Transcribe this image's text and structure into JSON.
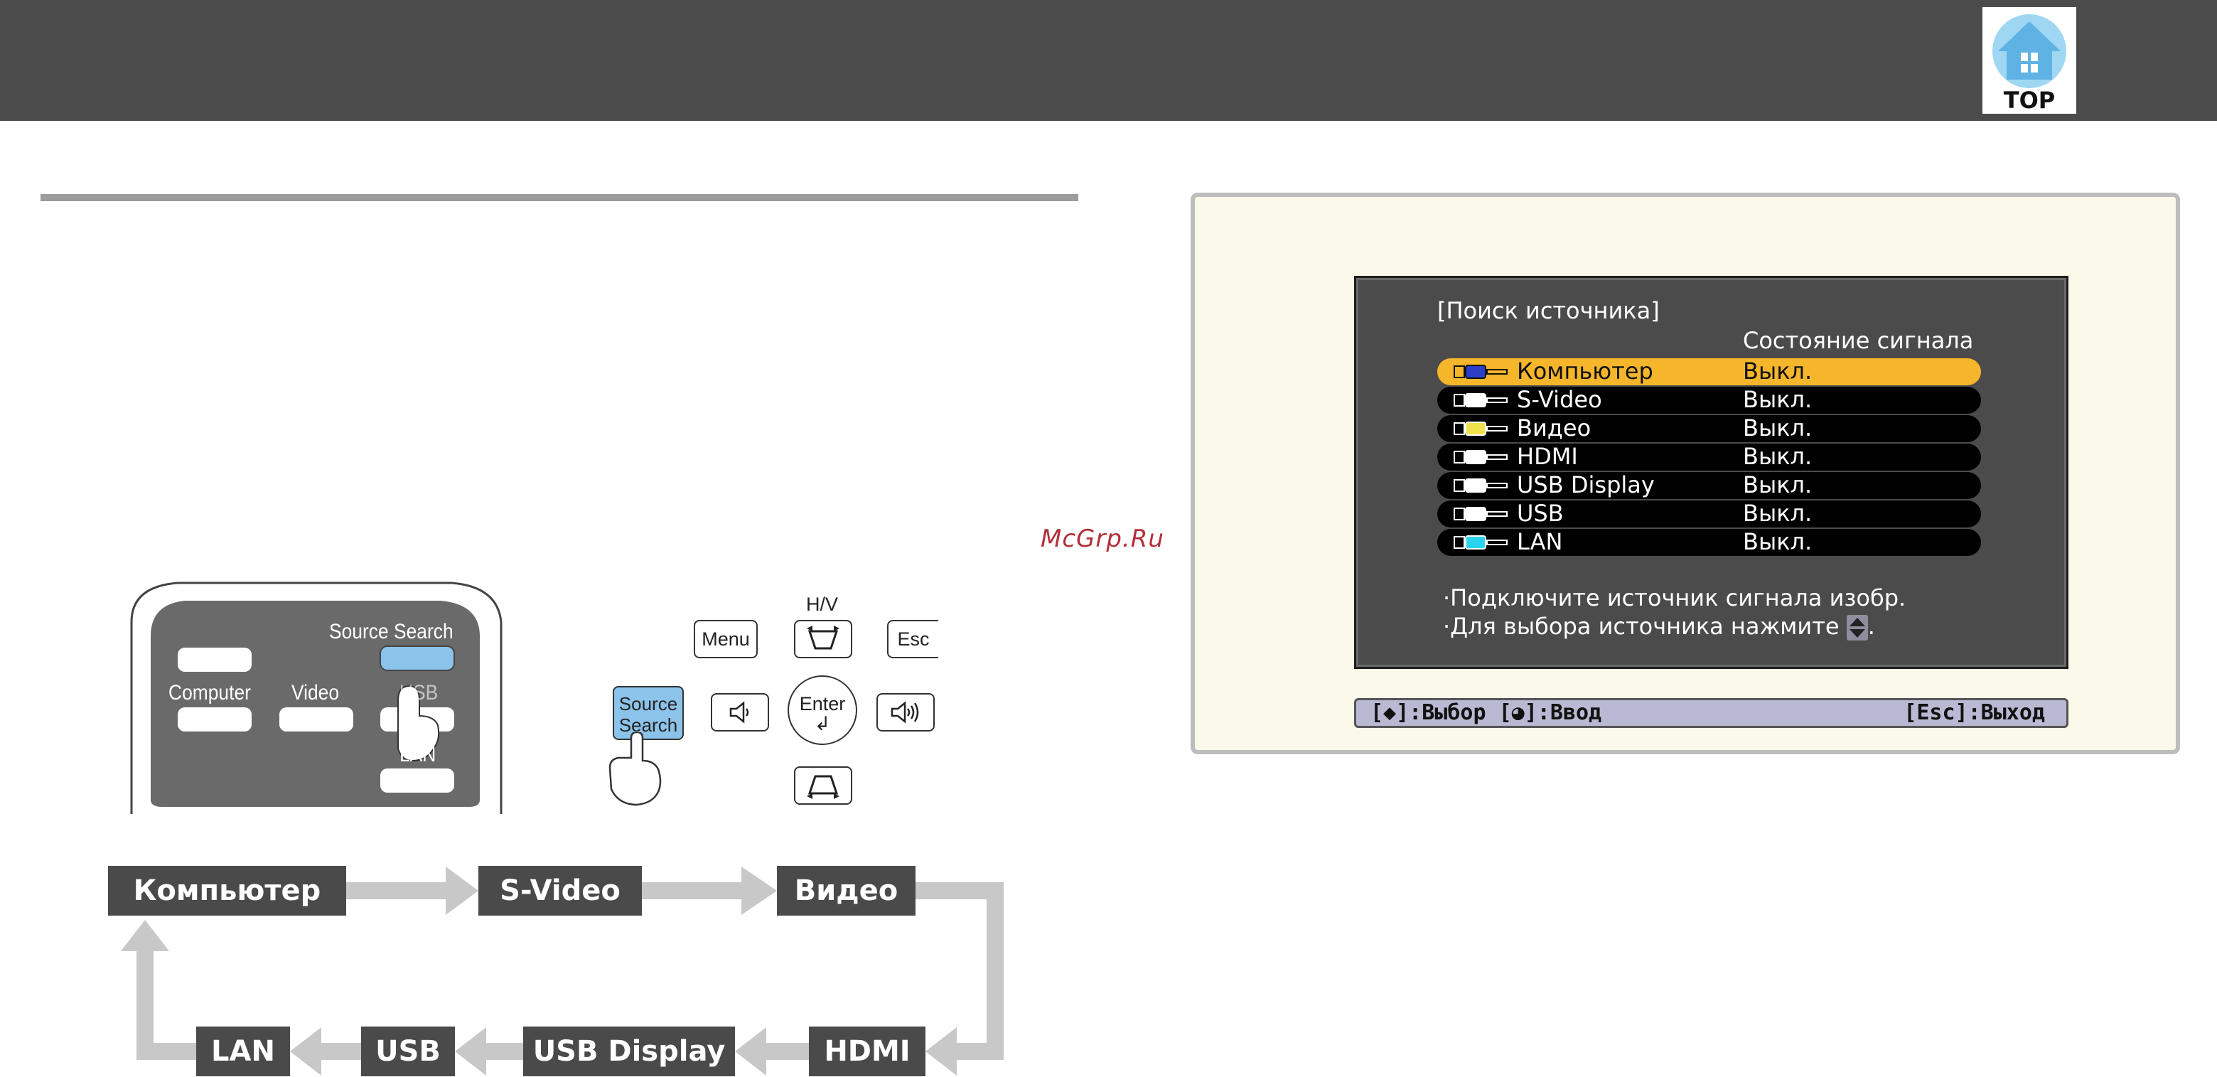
{
  "header": {
    "logo_text": "TOP"
  },
  "watermark": "McGrp.Ru",
  "screen": {
    "title": "[Поиск источника]",
    "column_header": "Состояние сигнала",
    "sources": [
      {
        "name": "Компьютер",
        "status": "Выкл.",
        "icon": "computer-port-icon",
        "selected": true
      },
      {
        "name": "S-Video",
        "status": "Выкл.",
        "icon": "s-video-port-icon",
        "selected": false
      },
      {
        "name": "Видео",
        "status": "Выкл.",
        "icon": "video-port-icon",
        "selected": false
      },
      {
        "name": "HDMI",
        "status": "Выкл.",
        "icon": "hdmi-port-icon",
        "selected": false
      },
      {
        "name": "USB Display",
        "status": "Выкл.",
        "icon": "usb-display-port-icon",
        "selected": false
      },
      {
        "name": "USB",
        "status": "Выкл.",
        "icon": "usb-port-icon",
        "selected": false
      },
      {
        "name": "LAN",
        "status": "Выкл.",
        "icon": "lan-wireless-icon",
        "selected": false
      }
    ],
    "message_1": "·Подключите источник сигнала изобр.",
    "message_2": "·Для выбора источника нажмите",
    "message_2_end": ".",
    "help_left": "[◆]:Выбор [◕]:Ввод",
    "help_right": "[Esc]:Выход"
  },
  "remote": {
    "source_search": "Source Search",
    "computer": "Computer",
    "video": "Video",
    "usb": "USB",
    "lan": "LAN"
  },
  "control_panel": {
    "hv": "H/V",
    "menu": "Menu",
    "esc": "Esc",
    "source_search_line1": "Source",
    "source_search_line2": "Search",
    "enter": "Enter"
  },
  "flow": {
    "computer": "Компьютер",
    "s_video": "S-Video",
    "video": "Видео",
    "hdmi": "HDMI",
    "usb_display": "USB Display",
    "usb": "USB",
    "lan": "LAN"
  }
}
